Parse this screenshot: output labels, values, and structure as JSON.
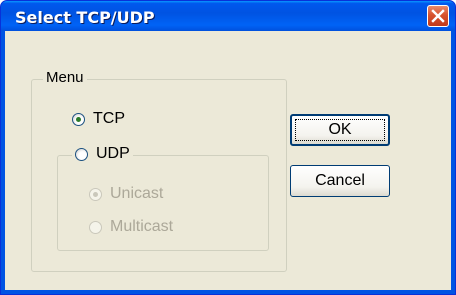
{
  "window": {
    "title": "Select TCP/UDP",
    "close_icon": "close-icon"
  },
  "menu_group": {
    "label": "Menu",
    "tcp": {
      "label": "TCP",
      "checked": true,
      "enabled": true
    },
    "udp": {
      "label": "UDP",
      "checked": false,
      "enabled": true
    },
    "udp_options": {
      "unicast": {
        "label": "Unicast",
        "checked": true,
        "enabled": false
      },
      "multicast": {
        "label": "Multicast",
        "checked": false,
        "enabled": false
      }
    }
  },
  "buttons": {
    "ok_label": "OK",
    "cancel_label": "Cancel"
  },
  "colors": {
    "titlebar": "#0054e3",
    "dialog_bg": "#ece9d8",
    "close_button": "#d7532e"
  }
}
